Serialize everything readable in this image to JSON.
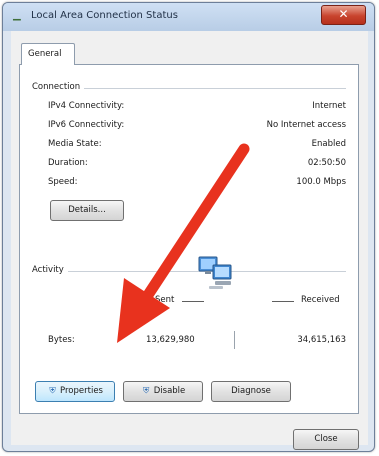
{
  "window": {
    "title": "Local Area Connection Status",
    "close_symbol": "✕"
  },
  "tabs": [
    {
      "label": "General"
    }
  ],
  "connection": {
    "heading": "Connection",
    "rows": [
      {
        "label": "IPv4 Connectivity:",
        "value": "Internet"
      },
      {
        "label": "IPv6 Connectivity:",
        "value": "No Internet access"
      },
      {
        "label": "Media State:",
        "value": "Enabled"
      },
      {
        "label": "Duration:",
        "value": "02:50:50"
      },
      {
        "label": "Speed:",
        "value": "100.0 Mbps"
      }
    ],
    "details_button": "Details..."
  },
  "activity": {
    "heading": "Activity",
    "sent_label": "Sent",
    "received_label": "Received",
    "bytes_label": "Bytes:",
    "bytes_sent": "13,629,980",
    "bytes_received": "34,615,163"
  },
  "buttons": {
    "properties": "Properties",
    "disable": "Disable",
    "diagnose": "Diagnose",
    "close": "Close"
  },
  "icons": {
    "title_icon": "network-connection-icon",
    "network_icon": "network-computers-icon",
    "properties_icon": "shield-icon",
    "disable_icon": "shield-icon"
  },
  "colors": {
    "annotation_arrow": "#e8321e",
    "close_button": "#c8442e"
  }
}
